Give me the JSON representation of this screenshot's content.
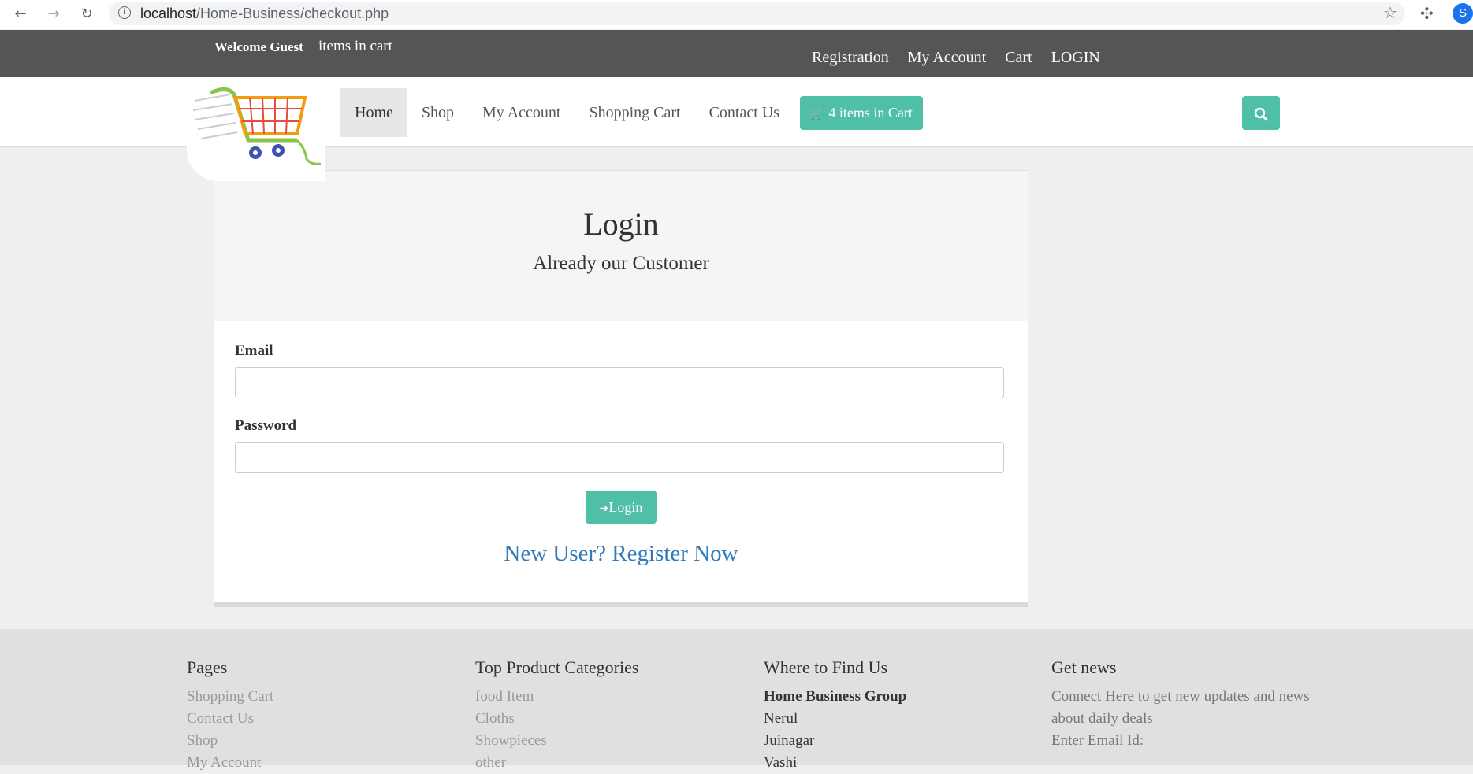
{
  "browser": {
    "url_host": "localhost",
    "url_path": "/Home-Business/checkout.php",
    "profile_initial": "S",
    "icons": [
      "back-arrow-icon",
      "forward-arrow-icon",
      "reload-icon",
      "info-icon",
      "star-icon",
      "puzzle-icon"
    ]
  },
  "topbar": {
    "welcome": "Welcome Guest",
    "items_in_cart": "items in cart",
    "links": [
      "Registration",
      "My Account",
      "Cart",
      "LOGIN"
    ]
  },
  "nav": {
    "menu": [
      "Home",
      "Shop",
      "My Account",
      "Shopping Cart",
      "Contact Us"
    ],
    "active": "Home",
    "cart_button": "4 items in Cart"
  },
  "login": {
    "title": "Login",
    "subtitle": "Already our Customer",
    "email_label": "Email",
    "email_value": "",
    "password_label": "Password",
    "password_value": "",
    "button": "Login",
    "register_link": "New User? Register Now"
  },
  "footer": {
    "pages": {
      "title": "Pages",
      "items": [
        "Shopping Cart",
        "Contact Us",
        "Shop",
        "My Account"
      ]
    },
    "categories": {
      "title": "Top Product Categories",
      "items": [
        "food Item",
        "Cloths",
        "Showpieces",
        "other"
      ]
    },
    "find_us": {
      "title": "Where to Find Us",
      "company": "Home Business Group",
      "items": [
        "Nerul",
        "Juinagar",
        "Vashi"
      ]
    },
    "news": {
      "title": "Get news",
      "text": "Connect Here to get new updates and news about daily deals",
      "enter_email": "Enter Email Id:"
    }
  },
  "colors": {
    "accent": "#4fbfa8",
    "topbar": "#555555",
    "link": "#337ab7"
  }
}
